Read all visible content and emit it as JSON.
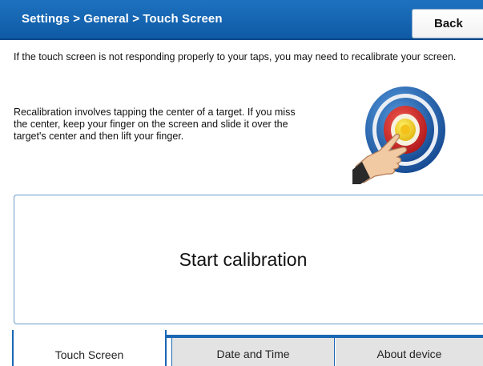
{
  "header": {
    "breadcrumb": "Settings > General > Touch Screen",
    "back_label": "Back"
  },
  "content": {
    "intro_text": "If the touch screen is not responding properly to your taps, you may need to recalibrate your screen.",
    "recalibration_text": "Recalibration involves tapping the center of a target. If you miss the center, keep your finger on the screen and slide it over the target's center and then lift your finger.",
    "start_button_label": "Start calibration",
    "illustration_icon": "target-with-finger-icon"
  },
  "tabs": [
    {
      "label": "Touch Screen",
      "active": true
    },
    {
      "label": "Date and Time",
      "active": false
    },
    {
      "label": "About device",
      "active": false
    }
  ],
  "colors": {
    "header_blue": "#1565b5",
    "accent_blue": "#1a67b4",
    "inactive_tab": "#e3e3e3",
    "target_red": "#d9262b",
    "target_yellow": "#f3d21a",
    "target_blue": "#1d5fb0"
  }
}
